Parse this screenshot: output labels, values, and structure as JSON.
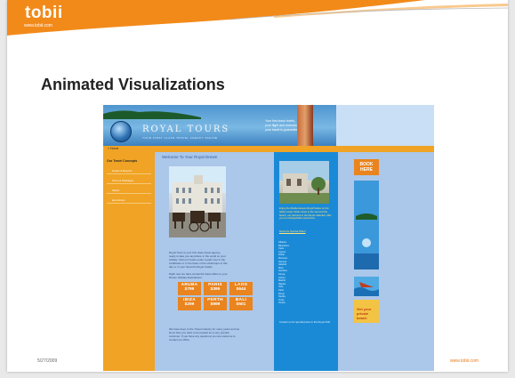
{
  "slide": {
    "logo": "tobii",
    "logo_url": "www.tobii.com",
    "title": "Animated Visualizations",
    "date": "5/27/2009",
    "footer_url": "www.tobii.com",
    "accent_color": "#f28a1a"
  },
  "site": {
    "banner": {
      "title": "ROYAL TOURS",
      "subtitle": "YOUR FIRST CLASS TRAVEL AGENCY ONLINE",
      "promo_lines": [
        "Your first class hotels,",
        "your flight and excursion",
        "your travel is guaranteed!"
      ]
    },
    "nav": {
      "home": "> Home"
    },
    "sidebar": {
      "heading": "Our Travel Concepts",
      "items": [
        "Hotels & Resorts",
        "Tours & Packages",
        "Island",
        "Excursions"
      ]
    },
    "content": {
      "welcome": "Welcome To Your Royal Dream",
      "para1": "Royal Tours is your first class travel agency, ready to take you anywhere in the world on your holiday. Visit our hotels under a palm tree in the Caribbean or in the heart of the old Europe in this day or in your favourite Royal Castle.",
      "para2": "Right now we have wonderful travel offers to your Dream Holiday destinations:",
      "prices": [
        {
          "city": "ARUBA",
          "amount": "$799"
        },
        {
          "city": "PARIS",
          "amount": "$399"
        },
        {
          "city": "LAOS",
          "amount": "$644"
        },
        {
          "city": "IBIZA",
          "amount": "$299"
        },
        {
          "city": "PERTH",
          "amount": "$999"
        },
        {
          "city": "BALI",
          "amount": "$501"
        }
      ],
      "para3": "We have been in the Travel Industry for many years and we know how you want to be treated as a very popular customer. If you have any questions you are welcome to contact our office."
    },
    "middle": {
      "caption": "Enjoy the Mediterranean Royal Suites on the Italian coast. Relax close to the sea and the beach, our partners in the Royal collection offer you an unforgettable experience.",
      "link": "Read the Special Offers",
      "list": [
        "Albania",
        "Barcelona",
        "Cairo",
        "Cyprus",
        "Dubai",
        "Florence",
        "Geneva",
        "Helsinki",
        "Ibiza",
        "Jamaica",
        "Kenya",
        "Lisbon",
        "Madrid",
        "Naples",
        "Oslo",
        "Paris",
        "Rome",
        "Sevilla",
        "Tunis",
        "Venice"
      ],
      "footer": "Contact us for special prices in the Royal Club"
    },
    "right": {
      "book_label_1": "BOOK",
      "book_label_2": "HERE",
      "ad_text_1": "Get your",
      "ad_text_2": "private",
      "ad_text_3": "beach"
    }
  }
}
